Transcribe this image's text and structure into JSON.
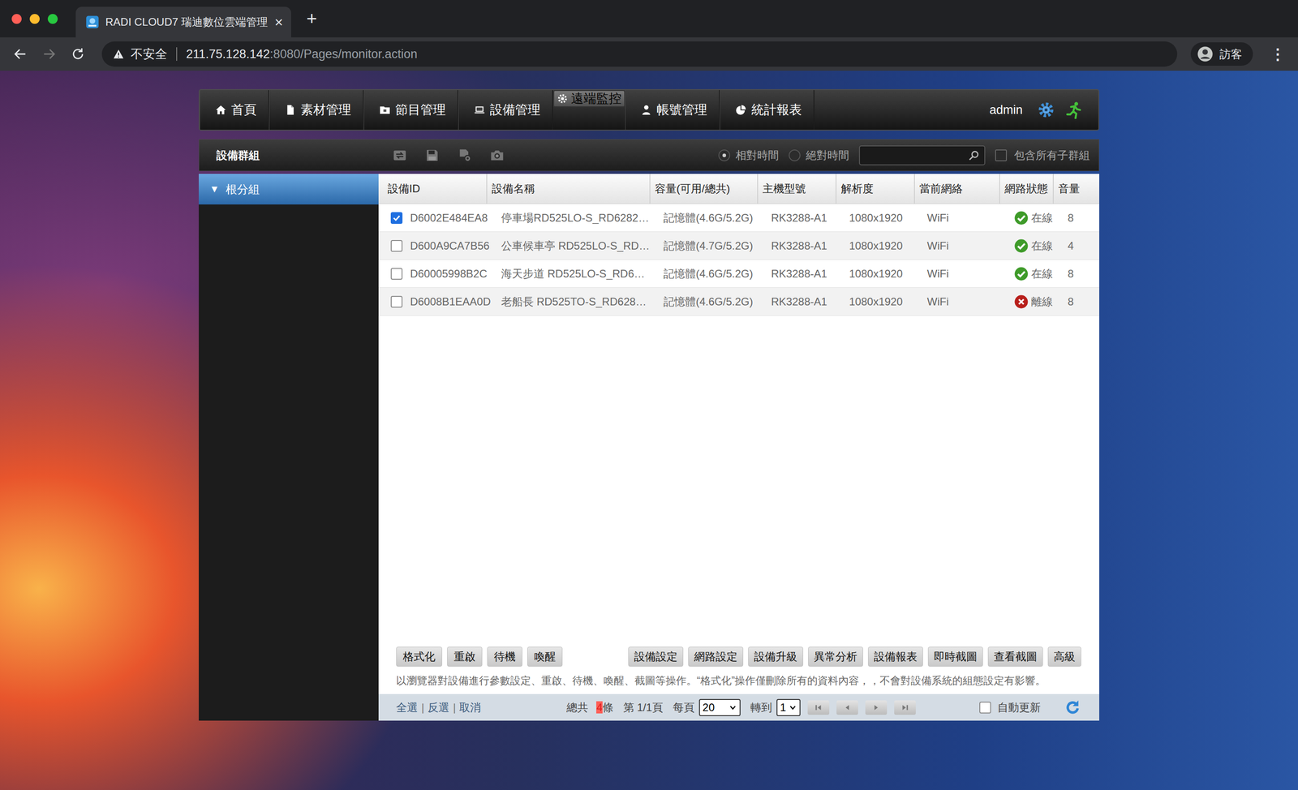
{
  "browser": {
    "tab_title": "RADI CLOUD7 瑞迪數位雲端管理",
    "tab_close": "×",
    "new_tab": "+",
    "security": "不安全",
    "url_host": "211.75.128.142",
    "url_path": ":8080/Pages/monitor.action",
    "profile": "訪客",
    "menu": "⋮"
  },
  "nav": {
    "items": [
      {
        "label": "首頁",
        "selected": false
      },
      {
        "label": "素材管理",
        "selected": false
      },
      {
        "label": "節目管理",
        "selected": false
      },
      {
        "label": "設備管理",
        "selected": false
      },
      {
        "label": "遠端監控",
        "selected": true
      },
      {
        "label": "帳號管理",
        "selected": false
      },
      {
        "label": "統計報表",
        "selected": false
      }
    ],
    "user": "admin"
  },
  "toolbar": {
    "title": "設備群組",
    "time_modes": [
      {
        "label": "相對時間",
        "selected": true
      },
      {
        "label": "絕對時間",
        "selected": false
      }
    ],
    "include_subgroups": {
      "label": "包含所有子群組",
      "checked": false
    }
  },
  "sidebar": {
    "items": [
      {
        "label": "根分組",
        "toggle": "▼",
        "expanded": true,
        "selected": true
      }
    ]
  },
  "table": {
    "columns": [
      "設備ID",
      "設備名稱",
      "容量(可用/總共)",
      "主機型號",
      "解析度",
      "當前網絡",
      "網路狀態",
      "音量"
    ],
    "rows": [
      {
        "checked": true,
        "id": "D6002E484EA8",
        "name": "停車場RD525LO-S_RD6282…",
        "capacity": "記憶體(4.6G/5.2G)",
        "model": "RK3288-A1",
        "resolution": "1080x1920",
        "network": "WiFi",
        "status": "在線",
        "online": true,
        "color": "#3f9b2a",
        "volume": "8"
      },
      {
        "checked": false,
        "id": "D600A9CA7B56",
        "name": "公車候車亭 RD525LO-S_RD…",
        "capacity": "記憶體(4.7G/5.2G)",
        "model": "RK3288-A1",
        "resolution": "1080x1920",
        "network": "WiFi",
        "status": "在線",
        "online": true,
        "color": "#3f9b2a",
        "volume": "4"
      },
      {
        "checked": false,
        "id": "D60005998B2C",
        "name": "海天步道 RD525LO-S_RD6…",
        "capacity": "記憶體(4.6G/5.2G)",
        "model": "RK3288-A1",
        "resolution": "1080x1920",
        "network": "WiFi",
        "status": "在線",
        "online": true,
        "color": "#3f9b2a",
        "volume": "8"
      },
      {
        "checked": false,
        "id": "D6008B1EAA0D",
        "name": "老船長 RD525TO-S_RD628…",
        "capacity": "記憶體(4.6G/5.2G)",
        "model": "RK3288-A1",
        "resolution": "1080x1920",
        "network": "WiFi",
        "status": "離線",
        "online": false,
        "color": "#b8201c",
        "volume": "8"
      }
    ]
  },
  "actions": {
    "left": [
      "格式化",
      "重啟",
      "待機",
      "喚醒"
    ],
    "right": [
      "設備設定",
      "網路設定",
      "設備升級",
      "異常分析",
      "設備報表",
      "即時截圖",
      "查看截圖",
      "高級"
    ]
  },
  "hint": "以瀏覽器對設備進行參數設定、重啟、待機、喚醒、截圖等操作。“格式化”操作僅刪除所有的資料內容，，不會對設備系統的組態設定有影響。",
  "pager": {
    "links": [
      "全選",
      "反選",
      "取消"
    ],
    "separator": "|",
    "total_label": "總共",
    "total": "4",
    "total_unit": "條",
    "page_info": "第 1/1頁",
    "per_page_label": "每頁",
    "per_page": "20",
    "goto_label": "轉到",
    "goto": "1",
    "auto_refresh": {
      "label": "自動更新",
      "checked": false
    }
  }
}
